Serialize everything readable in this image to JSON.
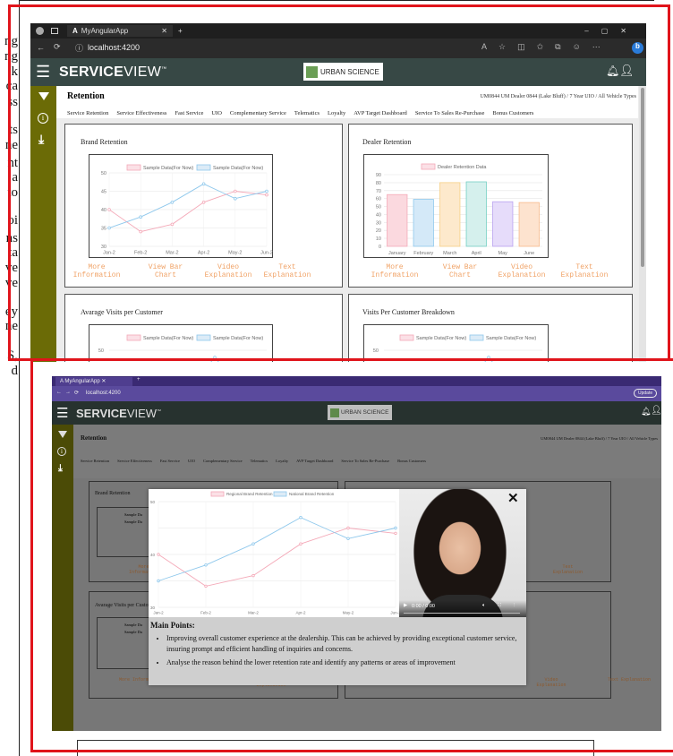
{
  "doc_fragments": [
    "ng",
    "ng",
    "k",
    "ca",
    "ss",
    "ts",
    "ne",
    "nt",
    "a",
    "to",
    "oi",
    "ns",
    "ta",
    "ve",
    "ve",
    "ey",
    "ne",
    "S,",
    "d"
  ],
  "top": {
    "tab_title": "MyAngularApp",
    "url": "localhost:4200",
    "brand_bold": "SERVICE",
    "brand_light": "VIEW",
    "brand_tm": "™",
    "partner": "URBAN SCIENCE",
    "page_title": "Retention",
    "context": "UM0844 UM Dealer 0844 (Lake Bluff) / 7 Year UIO / All Vehicle Types",
    "nav": [
      "Service Retention",
      "Service Effectiveness",
      "Fast Service",
      "UIO",
      "Complementary Service",
      "Telematics",
      "Loyalty",
      "AVP Target Dashboard",
      "Service To Sales Re-Purchase",
      "Bonus Customers"
    ],
    "panels": {
      "brand": {
        "title": "Brand Retention",
        "legend": [
          "Sample Data(For Now)",
          "Sample Data(For Now)"
        ]
      },
      "dealer": {
        "title": "Dealer Retention",
        "legend": [
          "Dealer Retention Data"
        ]
      },
      "avg": {
        "title": "Avarage Visits per Customer",
        "legend": [
          "Sample Data(For Now)",
          "Sample Data(For Now)"
        ],
        "y_top": "50"
      },
      "breakdown": {
        "title": "Visits Per Customer Breakdown",
        "legend": [
          "Sample Data(For Now)",
          "Sample Data(For Now)"
        ],
        "y_top": "50"
      }
    },
    "links": [
      "More Information",
      "View Bar Chart",
      "Video Explanation",
      "Text Explanation"
    ]
  },
  "bottom": {
    "tab_title": "MyAngularApp",
    "url": "localhost:4200",
    "update_label": "Update",
    "brand_bold": "SERVICE",
    "brand_light": "VIEW",
    "brand_tm": "™",
    "partner": "URBAN SCIENCE",
    "page_title": "Retention",
    "context": "UM0844 UM Dealer 0844 (Lake Bluff) / 7 Year UIO / All Vehicle Types",
    "nav": [
      "Service Retention",
      "Service Effectiveness",
      "Fast Service",
      "UIO",
      "Complementary Service",
      "Telematics",
      "Loyalty",
      "AVP Target Dashboard",
      "Service To Sales Re-Purchase",
      "Bonus Customers"
    ],
    "panel_titles": [
      "Brand Retention",
      "Avarage Visits per Customer"
    ],
    "bg_legend": [
      "Sample Da",
      "Sample Da"
    ],
    "bg_links_left": [
      "More",
      "Information"
    ],
    "bg_links_right": [
      "Text",
      "Explanation"
    ],
    "bg_links_bottom": [
      "More Information",
      "View Bar Chart",
      "Video Explanation",
      "More Information",
      "View Bar Chart",
      "Video Explanation",
      "Text Explanation"
    ],
    "modal": {
      "legend": [
        "Regional Brand Retention",
        "National Brand Retention"
      ],
      "video_time": "0:00 / 0:00",
      "main_points_title": "Main Points:",
      "points": [
        "Improving overall customer experience at the dealership. This can be achieved by providing exceptional customer service, insuring prompt and efficient handling of inquiries and concerns.",
        "Analyse the reason behind the lower retention rate and identify any patterns or areas of improvement"
      ]
    }
  },
  "colors": {
    "frame": "#e0141b",
    "appbar": "#374845",
    "sidebar": "#6b6b06",
    "pink": "#f4a9b8",
    "blue": "#8fc8ec",
    "link": "#f0a266"
  },
  "chart_data": [
    {
      "type": "line",
      "title": "Brand Retention",
      "categories": [
        "Jan-2",
        "Feb-2",
        "Mar-2",
        "Apr-2",
        "May-2",
        "Jun-2"
      ],
      "ylim": [
        30,
        50
      ],
      "series": [
        {
          "name": "Sample Data(For Now)",
          "values": [
            40,
            34,
            36,
            42,
            45,
            44
          ]
        },
        {
          "name": "Sample Data(For Now)",
          "values": [
            35,
            38,
            42,
            47,
            43,
            45
          ]
        }
      ]
    },
    {
      "type": "bar",
      "title": "Dealer Retention",
      "categories": [
        "January",
        "February",
        "March",
        "April",
        "May",
        "June"
      ],
      "ylim": [
        0,
        90
      ],
      "series": [
        {
          "name": "Dealer Retention Data",
          "values": [
            65,
            59,
            80,
            81,
            56,
            55
          ]
        }
      ]
    },
    {
      "type": "line",
      "title": "",
      "categories": [
        "Jan-2",
        "Feb-2",
        "Mar-2",
        "Apr-2",
        "May-2",
        "Jun-2"
      ],
      "ylim": [
        30,
        50
      ],
      "series": [
        {
          "name": "Regional Brand Retention",
          "values": [
            40,
            34,
            36,
            42,
            45,
            44
          ]
        },
        {
          "name": "National Brand Retention",
          "values": [
            35,
            38,
            42,
            47,
            43,
            45
          ]
        }
      ]
    }
  ]
}
